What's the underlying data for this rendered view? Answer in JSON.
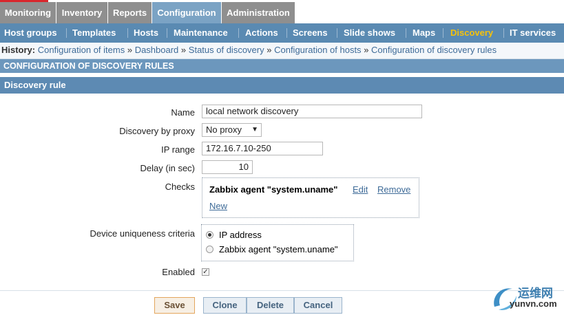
{
  "main_menu": {
    "items": [
      "Monitoring",
      "Inventory",
      "Reports",
      "Configuration",
      "Administration"
    ],
    "active": "Configuration"
  },
  "sub_menu": {
    "items": [
      "Host groups",
      "Templates",
      "Hosts",
      "Maintenance",
      "Actions",
      "Screens",
      "Slide shows",
      "Maps",
      "Discovery",
      "IT services"
    ],
    "active": "Discovery"
  },
  "history": {
    "label": "History:",
    "separator": "»",
    "links": [
      "Configuration of items",
      "Dashboard",
      "Status of discovery",
      "Configuration of hosts",
      "Configuration of discovery rules"
    ]
  },
  "page_title": "CONFIGURATION OF DISCOVERY RULES",
  "form": {
    "title": "Discovery rule",
    "name_label": "Name",
    "name_value": "local network discovery",
    "proxy_label": "Discovery by proxy",
    "proxy_value": "No proxy",
    "ip_range_label": "IP range",
    "ip_range_value": "172.16.7.10-250",
    "delay_label": "Delay (in sec)",
    "delay_value": "10",
    "checks_label": "Checks",
    "check_item": "Zabbix agent \"system.uname\"",
    "edit_link": "Edit",
    "remove_link": "Remove",
    "new_link": "New",
    "uniqueness_label": "Device uniqueness criteria",
    "uniqueness_options": [
      "IP address",
      "Zabbix agent \"system.uname\""
    ],
    "uniqueness_selected": "IP address",
    "enabled_label": "Enabled",
    "enabled": true
  },
  "buttons": {
    "save": "Save",
    "clone": "Clone",
    "delete": "Delete",
    "cancel": "Cancel"
  },
  "watermark": {
    "text_cn": "运维网",
    "text_url": "yunvn.com"
  },
  "colors": {
    "main_menu_bg": "#8f8f8f",
    "main_menu_active": "#7ba3c4",
    "sub_menu_bg": "#5a8ab2",
    "sub_menu_active_text": "#f5c20b",
    "header_bg": "#6c97bd",
    "link": "#3e6b98",
    "annotation_red": "#d9262c"
  }
}
